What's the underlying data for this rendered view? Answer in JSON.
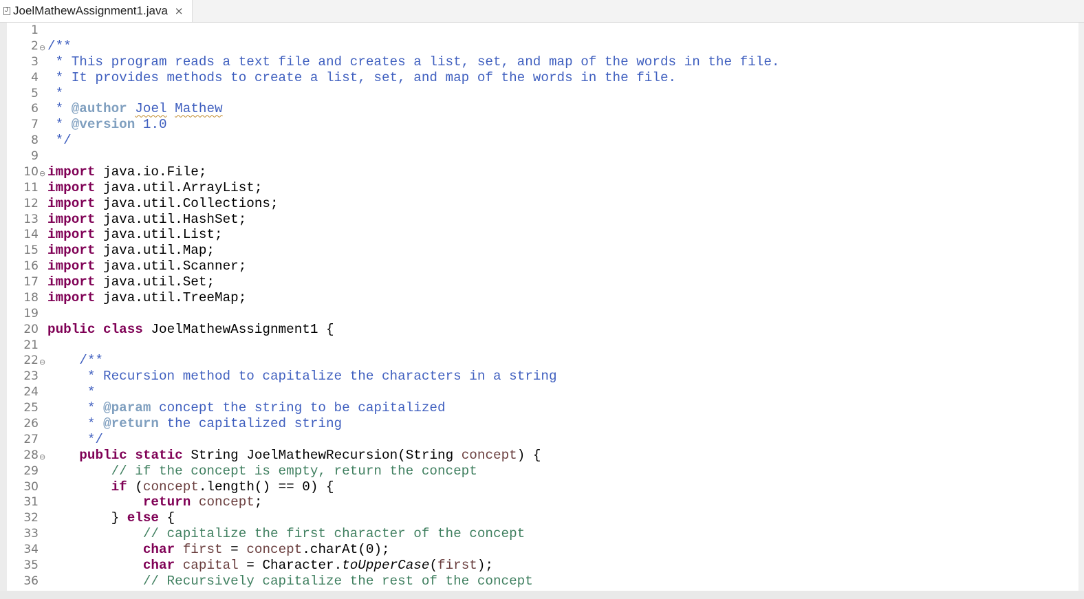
{
  "tab": {
    "title": "JoelMathewAssignment1.java",
    "close": "×"
  },
  "colors": {
    "javadoc": "#3f5fbf",
    "javadoc_tag": "#7f9fbf",
    "keyword": "#7f0055",
    "comment": "#3f7f5f",
    "variable": "#6a3e3e",
    "line_number": "#7a7a7a"
  },
  "lines": [
    {
      "n": "1",
      "fold": "",
      "tokens": []
    },
    {
      "n": "2",
      "fold": "⊖",
      "tokens": [
        {
          "t": "/**",
          "c": "javadoc"
        }
      ]
    },
    {
      "n": "3",
      "fold": "",
      "tokens": [
        {
          "t": " * This program reads a text file and creates a list, set, and map of the words in the file.",
          "c": "javadoc"
        }
      ]
    },
    {
      "n": "4",
      "fold": "",
      "tokens": [
        {
          "t": " * It provides methods to create a list, set, and map of the words in the file.",
          "c": "javadoc"
        }
      ]
    },
    {
      "n": "5",
      "fold": "",
      "tokens": [
        {
          "t": " *",
          "c": "javadoc"
        }
      ]
    },
    {
      "n": "6",
      "fold": "",
      "tokens": [
        {
          "t": " * ",
          "c": "javadoc"
        },
        {
          "t": "@author",
          "c": "tag"
        },
        {
          "t": " ",
          "c": "javadoc"
        },
        {
          "t": "Joel",
          "c": "javadoc",
          "sq": true
        },
        {
          "t": " ",
          "c": "javadoc"
        },
        {
          "t": "Mathew",
          "c": "javadoc",
          "sq": true
        }
      ]
    },
    {
      "n": "7",
      "fold": "",
      "tokens": [
        {
          "t": " * ",
          "c": "javadoc"
        },
        {
          "t": "@version",
          "c": "tag"
        },
        {
          "t": " 1.0",
          "c": "javadoc"
        }
      ]
    },
    {
      "n": "8",
      "fold": "",
      "tokens": [
        {
          "t": " */",
          "c": "javadoc"
        }
      ]
    },
    {
      "n": "9",
      "fold": "",
      "tokens": []
    },
    {
      "n": "10",
      "fold": "⊖",
      "tokens": [
        {
          "t": "import",
          "c": "kw"
        },
        {
          "t": " java.io.File;",
          "c": "plain"
        }
      ]
    },
    {
      "n": "11",
      "fold": "",
      "tokens": [
        {
          "t": "import",
          "c": "kw"
        },
        {
          "t": " java.util.ArrayList;",
          "c": "plain"
        }
      ]
    },
    {
      "n": "12",
      "fold": "",
      "tokens": [
        {
          "t": "import",
          "c": "kw"
        },
        {
          "t": " java.util.Collections;",
          "c": "plain"
        }
      ]
    },
    {
      "n": "13",
      "fold": "",
      "tokens": [
        {
          "t": "import",
          "c": "kw"
        },
        {
          "t": " java.util.HashSet;",
          "c": "plain"
        }
      ]
    },
    {
      "n": "14",
      "fold": "",
      "tokens": [
        {
          "t": "import",
          "c": "kw"
        },
        {
          "t": " java.util.List;",
          "c": "plain"
        }
      ]
    },
    {
      "n": "15",
      "fold": "",
      "tokens": [
        {
          "t": "import",
          "c": "kw"
        },
        {
          "t": " java.util.Map;",
          "c": "plain"
        }
      ]
    },
    {
      "n": "16",
      "fold": "",
      "tokens": [
        {
          "t": "import",
          "c": "kw"
        },
        {
          "t": " java.util.Scanner;",
          "c": "plain"
        }
      ]
    },
    {
      "n": "17",
      "fold": "",
      "tokens": [
        {
          "t": "import",
          "c": "kw"
        },
        {
          "t": " java.util.Set;",
          "c": "plain"
        }
      ]
    },
    {
      "n": "18",
      "fold": "",
      "tokens": [
        {
          "t": "import",
          "c": "kw"
        },
        {
          "t": " java.util.TreeMap;",
          "c": "plain"
        }
      ]
    },
    {
      "n": "19",
      "fold": "",
      "tokens": []
    },
    {
      "n": "20",
      "fold": "",
      "tokens": [
        {
          "t": "public",
          "c": "kw"
        },
        {
          "t": " ",
          "c": "plain"
        },
        {
          "t": "class",
          "c": "kw"
        },
        {
          "t": " JoelMathewAssignment1 {",
          "c": "plain"
        }
      ]
    },
    {
      "n": "21",
      "fold": "",
      "tokens": []
    },
    {
      "n": "22",
      "fold": "⊖",
      "tokens": [
        {
          "t": "    /**",
          "c": "javadoc"
        }
      ]
    },
    {
      "n": "23",
      "fold": "",
      "tokens": [
        {
          "t": "     * Recursion method to capitalize the characters in a string",
          "c": "javadoc"
        }
      ]
    },
    {
      "n": "24",
      "fold": "",
      "tokens": [
        {
          "t": "     *",
          "c": "javadoc"
        }
      ]
    },
    {
      "n": "25",
      "fold": "",
      "tokens": [
        {
          "t": "     * ",
          "c": "javadoc"
        },
        {
          "t": "@param",
          "c": "tag"
        },
        {
          "t": " concept the string to be capitalized",
          "c": "javadoc"
        }
      ]
    },
    {
      "n": "26",
      "fold": "",
      "tokens": [
        {
          "t": "     * ",
          "c": "javadoc"
        },
        {
          "t": "@return",
          "c": "tag"
        },
        {
          "t": " the capitalized string",
          "c": "javadoc"
        }
      ]
    },
    {
      "n": "27",
      "fold": "",
      "tokens": [
        {
          "t": "     */",
          "c": "javadoc"
        }
      ]
    },
    {
      "n": "28",
      "fold": "⊖",
      "tokens": [
        {
          "t": "    ",
          "c": "plain"
        },
        {
          "t": "public",
          "c": "kw"
        },
        {
          "t": " ",
          "c": "plain"
        },
        {
          "t": "static",
          "c": "kw"
        },
        {
          "t": " String JoelMathewRecursion(String ",
          "c": "plain"
        },
        {
          "t": "concept",
          "c": "var"
        },
        {
          "t": ") {",
          "c": "plain"
        }
      ]
    },
    {
      "n": "29",
      "fold": "",
      "tokens": [
        {
          "t": "        // if the concept is empty, return the concept",
          "c": "comment"
        }
      ]
    },
    {
      "n": "30",
      "fold": "",
      "tokens": [
        {
          "t": "        ",
          "c": "plain"
        },
        {
          "t": "if",
          "c": "kw"
        },
        {
          "t": " (",
          "c": "plain"
        },
        {
          "t": "concept",
          "c": "var"
        },
        {
          "t": ".length() == 0) {",
          "c": "plain"
        }
      ]
    },
    {
      "n": "31",
      "fold": "",
      "tokens": [
        {
          "t": "            ",
          "c": "plain"
        },
        {
          "t": "return",
          "c": "kw"
        },
        {
          "t": " ",
          "c": "plain"
        },
        {
          "t": "concept",
          "c": "var"
        },
        {
          "t": ";",
          "c": "plain"
        }
      ]
    },
    {
      "n": "32",
      "fold": "",
      "tokens": [
        {
          "t": "        } ",
          "c": "plain"
        },
        {
          "t": "else",
          "c": "kw"
        },
        {
          "t": " {",
          "c": "plain"
        }
      ]
    },
    {
      "n": "33",
      "fold": "",
      "tokens": [
        {
          "t": "            // capitalize the first character of the concept",
          "c": "comment"
        }
      ]
    },
    {
      "n": "34",
      "fold": "",
      "tokens": [
        {
          "t": "            ",
          "c": "plain"
        },
        {
          "t": "char",
          "c": "kw"
        },
        {
          "t": " ",
          "c": "plain"
        },
        {
          "t": "first",
          "c": "var"
        },
        {
          "t": " = ",
          "c": "plain"
        },
        {
          "t": "concept",
          "c": "var"
        },
        {
          "t": ".charAt(0);",
          "c": "plain"
        }
      ]
    },
    {
      "n": "35",
      "fold": "",
      "tokens": [
        {
          "t": "            ",
          "c": "plain"
        },
        {
          "t": "char",
          "c": "kw"
        },
        {
          "t": " ",
          "c": "plain"
        },
        {
          "t": "capital",
          "c": "var"
        },
        {
          "t": " = Character.",
          "c": "plain"
        },
        {
          "t": "toUpperCase",
          "c": "italic"
        },
        {
          "t": "(",
          "c": "plain"
        },
        {
          "t": "first",
          "c": "var"
        },
        {
          "t": ");",
          "c": "plain"
        }
      ]
    },
    {
      "n": "36",
      "fold": "",
      "tokens": [
        {
          "t": "            // Recursively capitalize the rest of the concept",
          "c": "comment"
        }
      ]
    }
  ]
}
